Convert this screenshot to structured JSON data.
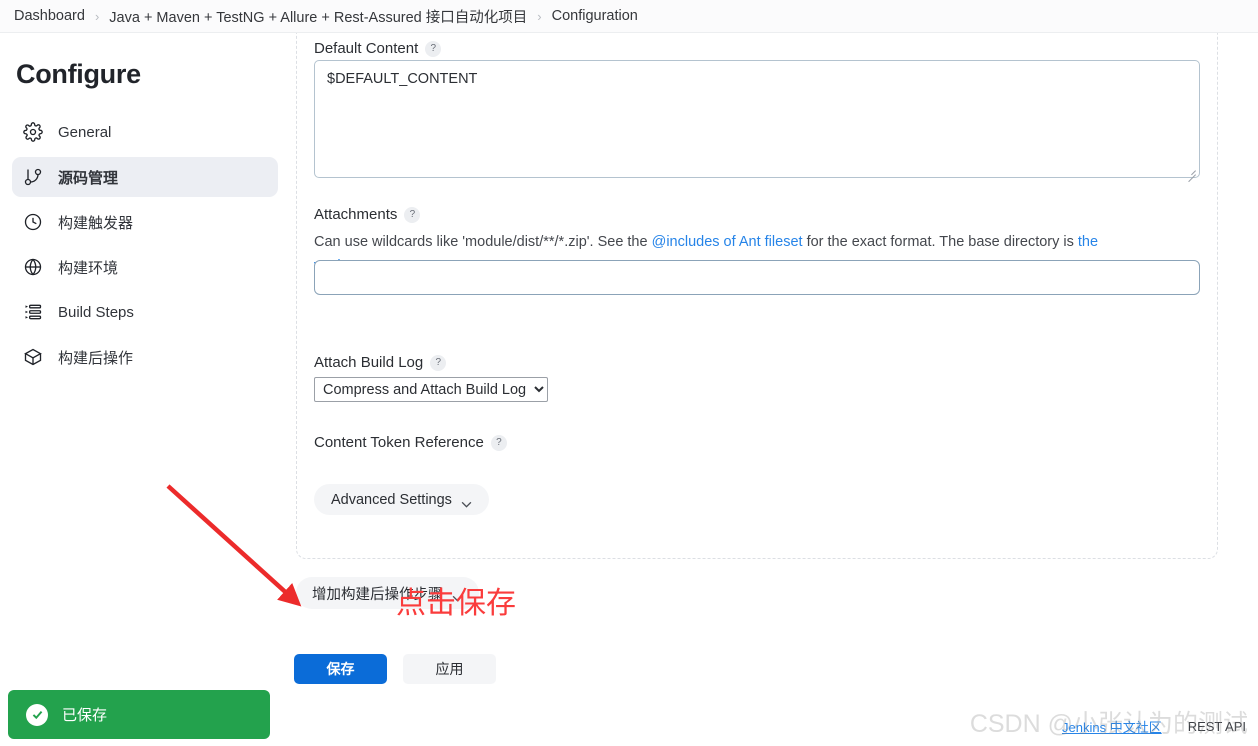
{
  "breadcrumb": {
    "items": [
      "Dashboard",
      "Java + Maven + TestNG + Allure + Rest-Assured 接口自动化项目",
      "Configuration"
    ],
    "separator": "›"
  },
  "sidebar": {
    "title": "Configure",
    "items": [
      {
        "label": "General",
        "icon": "gear-icon",
        "active": false
      },
      {
        "label": "源码管理",
        "icon": "git-branch-icon",
        "active": true
      },
      {
        "label": "构建触发器",
        "icon": "clock-icon",
        "active": false
      },
      {
        "label": "构建环境",
        "icon": "globe-icon",
        "active": false
      },
      {
        "label": "Build Steps",
        "icon": "list-icon",
        "active": false
      },
      {
        "label": "构建后操作",
        "icon": "package-icon",
        "active": false
      }
    ]
  },
  "form": {
    "default_content": {
      "label": "Default Content",
      "help_marker": "?",
      "value": "$DEFAULT_CONTENT"
    },
    "attachments": {
      "label": "Attachments",
      "help_marker": "?",
      "description_part1": "Can use wildcards like 'module/dist/**/*.zip'. See the ",
      "link1": "@includes of Ant fileset",
      "description_part2": " for the exact format. The base directory is ",
      "link2": "the workspace",
      "description_part3": ".",
      "value": "",
      "placeholder": ""
    },
    "attach_build_log": {
      "label": "Attach Build Log",
      "help_marker": "?",
      "selected": "Compress and Attach Build Log",
      "options": [
        "Compress and Attach Build Log"
      ]
    },
    "content_token_reference": {
      "label": "Content Token Reference",
      "help_marker": "?"
    },
    "advanced_settings_label": "Advanced Settings",
    "add_post_step_label": "增加构建后操作步骤"
  },
  "actions": {
    "save_label": "保存",
    "apply_label": "应用"
  },
  "annotation": {
    "text": "点击保存",
    "color": "#fa3c3c"
  },
  "toast": {
    "message": "已保存",
    "icon": "check-circle-icon",
    "color": "#23a24d"
  },
  "footer": {
    "links": [
      "Jenkins 中文社区",
      "REST API"
    ]
  },
  "watermark": {
    "text": "CSDN @小张认为的测试"
  },
  "colors": {
    "accent_blue": "#0b6cd8",
    "link_blue": "#2684e8",
    "success_green": "#23a24d",
    "annotation_red": "#fa3c3c"
  }
}
